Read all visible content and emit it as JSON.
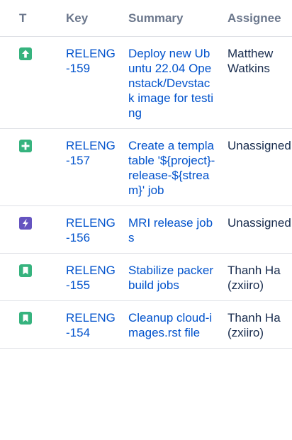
{
  "table": {
    "headers": {
      "type": "T",
      "key": "Key",
      "summary": "Summary",
      "assignee": "Assignee"
    },
    "rows": [
      {
        "type_icon": "improvement-icon",
        "type_color": "#36b37e",
        "key": "RELENG-159",
        "summary": "Deploy new Ubuntu 22.04 Openstack/Devstack image for testing",
        "assignee_line1": "Matthew",
        "assignee_line2": "Watkins"
      },
      {
        "type_icon": "new-feature-icon",
        "type_color": "#36b37e",
        "key": "RELENG-157",
        "summary": "Create a templatable '${project}-release-${stream}' job",
        "assignee_line1": "Unassigned",
        "assignee_line2": ""
      },
      {
        "type_icon": "epic-icon",
        "type_color": "#6554c0",
        "key": "RELENG-156",
        "summary": "MRI release jobs",
        "assignee_line1": "Unassigned",
        "assignee_line2": ""
      },
      {
        "type_icon": "story-icon",
        "type_color": "#36b37e",
        "key": "RELENG-155",
        "summary": "Stabilize packer build jobs",
        "assignee_line1": "Thanh Ha",
        "assignee_line2": "(zxiiro)"
      },
      {
        "type_icon": "story-icon",
        "type_color": "#36b37e",
        "key": "RELENG-154",
        "summary": "Cleanup cloud-images.rst file",
        "assignee_line1": "Thanh Ha",
        "assignee_line2": "(zxiiro)"
      }
    ]
  }
}
